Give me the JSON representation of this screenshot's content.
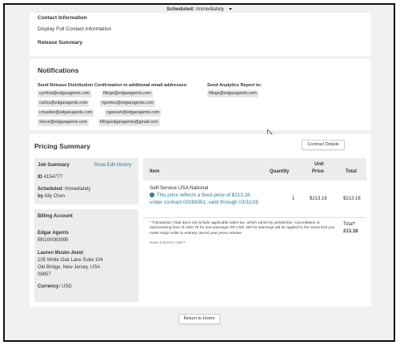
{
  "top_bar": {
    "scheduled_label": "Scheduled:",
    "scheduled_value": "Immediately"
  },
  "contact": {
    "heading": "Contact Information",
    "display": "Display Full Contact Information",
    "release_summary": "Release Summary"
  },
  "notifications": {
    "title": "Notifications",
    "distribution_label": "Send Release Distribution Confirmation to additional email addresses:",
    "analytics_label": "Send Analytics Report to:",
    "analytics_email": "filings@edgaragents.com",
    "emails": [
      "cynthia@edgaragents.com",
      "filings@edgaragents.com",
      "carlos@edgaragents.com",
      "ngomez@edgaragents.com",
      "cmueller@edgaragents.com",
      "cganesh@edgaragents.com",
      "Steve@edgaragents.com",
      "filingsedgaragents@gmail.com"
    ]
  },
  "pricing": {
    "title": "Pricing Summary",
    "contract_details_button": "Contract Details",
    "job_summary": {
      "title": "Job Summary",
      "show_edit_history": "Show Edit History",
      "id_label": "ID",
      "id_value": "4154777",
      "scheduled_label": "Scheduled:",
      "scheduled_value": "Immediately",
      "by_label": "by",
      "by_value": "Ally Chen"
    },
    "billing": {
      "title": "Billing Account",
      "company": "Edgar Agents",
      "account_no": "BN100083995",
      "contact_name": "Lauren Musto-Joest",
      "address1": "105 White Oak Lane Suite 104",
      "address2": "Old Bridge, New Jersey, USA",
      "zip": "08857",
      "currency_label": "Currency:",
      "currency_value": "USD"
    },
    "table": {
      "headers": {
        "item": "Item",
        "quantity": "Quantity",
        "unit_price_1": "Unit",
        "unit_price_2": "Price",
        "total": "Total"
      },
      "row": {
        "name": "Self-Service USA National",
        "note": "This price reflects a fixed-price of $213.18, under contract 00289361, valid through 03/31/26.",
        "quantity": "1",
        "unit_price": "$213.18",
        "total": "$213.18"
      }
    },
    "disclaimer": "* Transaction Total does not include applicable sales tax, which varies by jurisdiction. Cancellation or reprocessing fees of USD 75 for non-warnings OR USD 150 for warnings will be applied in the event that you make major edits or entirely cancel your press release.",
    "promo": "Have a promo code?",
    "total_label": "Total*:",
    "total_value": "213.18"
  },
  "return_button": "Return to Home"
}
